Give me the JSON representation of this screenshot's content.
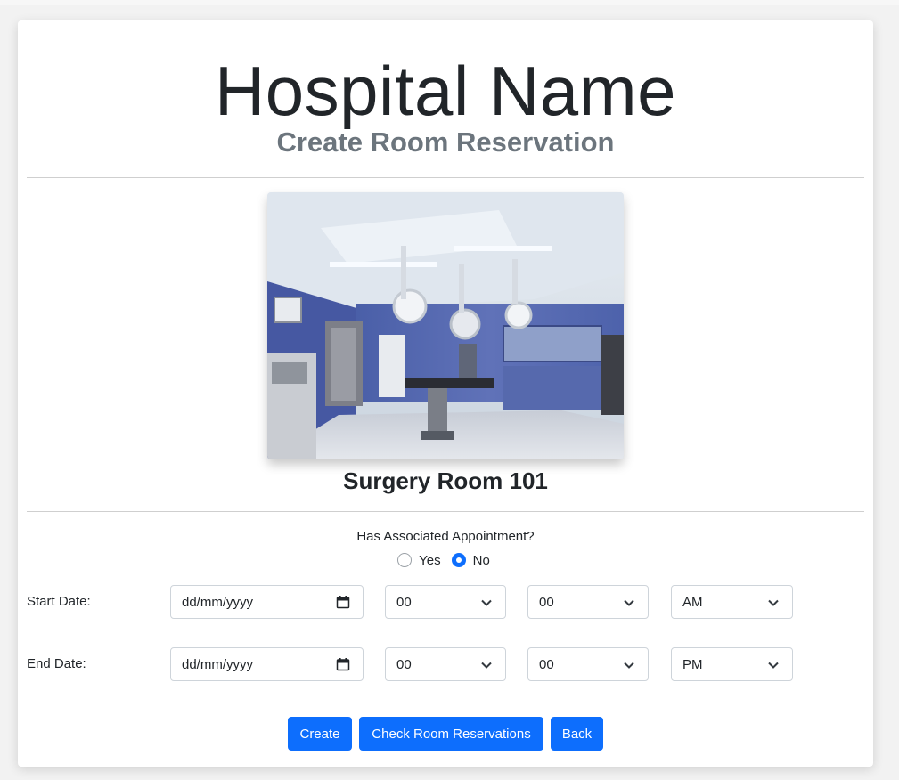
{
  "header": {
    "title": "Hospital Name",
    "subtitle": "Create Room Reservation"
  },
  "room": {
    "name": "Surgery Room 101",
    "photo_icon": "operating-room-photo"
  },
  "appointment": {
    "question": "Has Associated Appointment?",
    "options": [
      {
        "label": "Yes",
        "checked": false
      },
      {
        "label": "No",
        "checked": true
      }
    ]
  },
  "start": {
    "label": "Start Date:",
    "date_placeholder": "dd/mm/yyyy",
    "hour": "00",
    "minute": "00",
    "period": "AM"
  },
  "end": {
    "label": "End Date:",
    "date_placeholder": "dd/mm/yyyy",
    "hour": "00",
    "minute": "00",
    "period": "PM"
  },
  "buttons": {
    "create": "Create",
    "check": "Check Room Reservations",
    "back": "Back"
  },
  "colors": {
    "primary": "#0d6efd",
    "subtitle": "#6c757d",
    "text": "#212529"
  }
}
